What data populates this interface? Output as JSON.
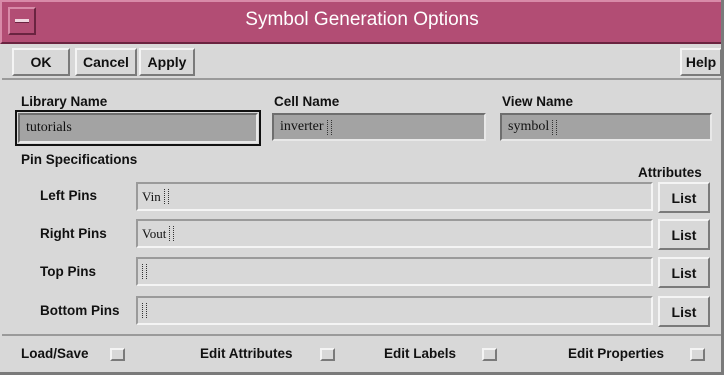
{
  "window": {
    "title": "Symbol Generation Options"
  },
  "toolbar": {
    "ok": "OK",
    "cancel": "Cancel",
    "apply": "Apply",
    "help": "Help"
  },
  "fields": {
    "library": {
      "label": "Library Name",
      "value": "tutorials"
    },
    "cell": {
      "label": "Cell Name",
      "value": "inverter"
    },
    "view": {
      "label": "View Name",
      "value": "symbol"
    }
  },
  "pins": {
    "section_label": "Pin Specifications",
    "attributes_label": "Attributes",
    "list_label": "List",
    "left": {
      "label": "Left Pins",
      "value": "Vin"
    },
    "right": {
      "label": "Right Pins",
      "value": "Vout"
    },
    "top": {
      "label": "Top Pins",
      "value": ""
    },
    "bottom": {
      "label": "Bottom Pins",
      "value": ""
    }
  },
  "options": {
    "load_save": "Load/Save",
    "edit_attributes": "Edit Attributes",
    "edit_labels": "Edit Labels",
    "edit_properties": "Edit Properties"
  }
}
